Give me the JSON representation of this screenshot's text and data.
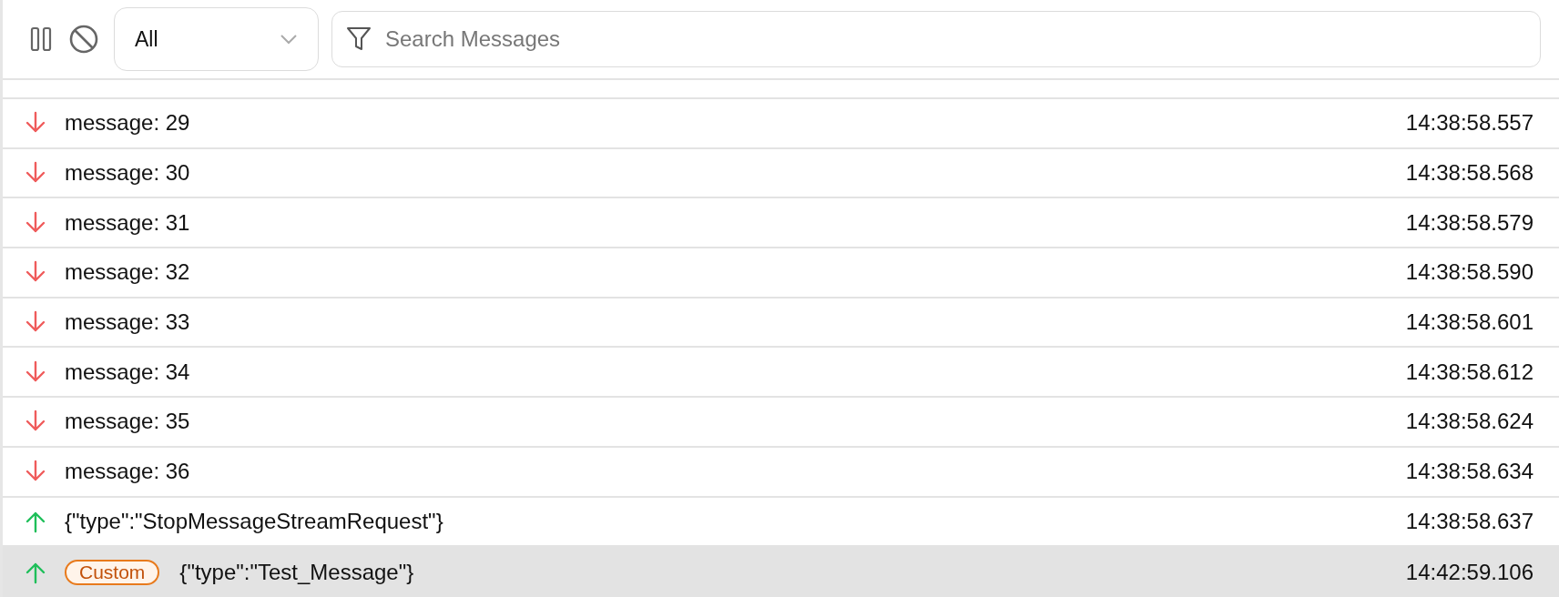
{
  "toolbar": {
    "filter": {
      "value": "All"
    },
    "search": {
      "placeholder": "Search Messages"
    }
  },
  "messages": [
    {
      "kind": "down",
      "text": "message: 29",
      "time": "14:38:58.557",
      "selected": false
    },
    {
      "kind": "down",
      "text": "message: 30",
      "time": "14:38:58.568",
      "selected": false
    },
    {
      "kind": "down",
      "text": "message: 31",
      "time": "14:38:58.579",
      "selected": false
    },
    {
      "kind": "down",
      "text": "message: 32",
      "time": "14:38:58.590",
      "selected": false
    },
    {
      "kind": "down",
      "text": "message: 33",
      "time": "14:38:58.601",
      "selected": false
    },
    {
      "kind": "down",
      "text": "message: 34",
      "time": "14:38:58.612",
      "selected": false
    },
    {
      "kind": "down",
      "text": "message: 35",
      "time": "14:38:58.624",
      "selected": false
    },
    {
      "kind": "down",
      "text": "message: 36",
      "time": "14:38:58.634",
      "selected": false
    },
    {
      "kind": "up",
      "text": "{\"type\":\"StopMessageStreamRequest\"}",
      "time": "14:38:58.637",
      "selected": false
    },
    {
      "kind": "up",
      "badge": "Custom",
      "text": "{\"type\":\"Test_Message\"}",
      "time": "14:42:59.106",
      "selected": true
    }
  ]
}
